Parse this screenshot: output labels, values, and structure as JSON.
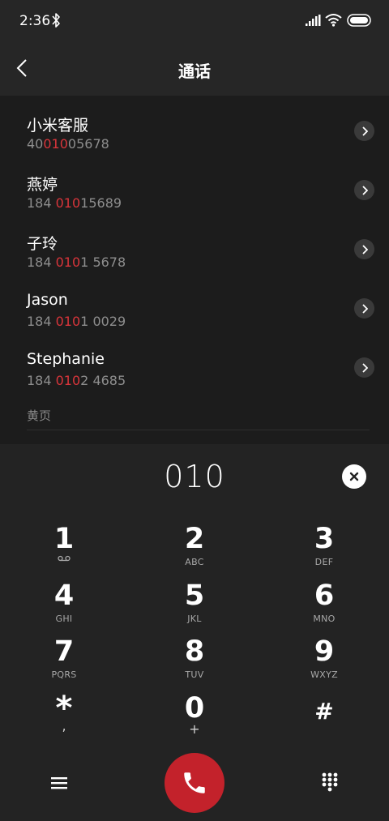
{
  "status_bar": {
    "time": "2:36",
    "icons": [
      "bluetooth-icon",
      "signal-icon",
      "wifi-icon",
      "battery-icon"
    ]
  },
  "header": {
    "title": "通话",
    "back_icon": "chevron-left-icon"
  },
  "contacts": [
    {
      "name": "小米客服",
      "number_pre": "40",
      "number_match": "010",
      "number_post": "05678"
    },
    {
      "name": "燕婷",
      "number_pre": "184 ",
      "number_match": "010",
      "number_post": "15689"
    },
    {
      "name": "子玲",
      "number_pre": "184 ",
      "number_match": "010",
      "number_post": "1 5678"
    },
    {
      "name": "Jason",
      "number_pre": "184 ",
      "number_match": "010",
      "number_post": "1 0029"
    },
    {
      "name": "Stephanie",
      "number_pre": "184 ",
      "number_match": "010",
      "number_post": "2 4685"
    }
  ],
  "yellow_pages_label": "黄页",
  "dialpad": {
    "entered_number": "010",
    "keys": [
      {
        "digit": "1",
        "letters": ""
      },
      {
        "digit": "2",
        "letters": "ABC"
      },
      {
        "digit": "3",
        "letters": "DEF"
      },
      {
        "digit": "4",
        "letters": "GHI"
      },
      {
        "digit": "5",
        "letters": "JKL"
      },
      {
        "digit": "6",
        "letters": "MNO"
      },
      {
        "digit": "7",
        "letters": "PQRS"
      },
      {
        "digit": "8",
        "letters": "TUV"
      },
      {
        "digit": "9",
        "letters": "WXYZ"
      },
      {
        "digit": "*",
        "letters": ","
      },
      {
        "digit": "0",
        "letters": "+"
      },
      {
        "digit": "#",
        "letters": ""
      }
    ]
  },
  "colors": {
    "accent_red": "#c3222b",
    "highlight_red": "#d9353b",
    "background": "#1b1b1b"
  }
}
